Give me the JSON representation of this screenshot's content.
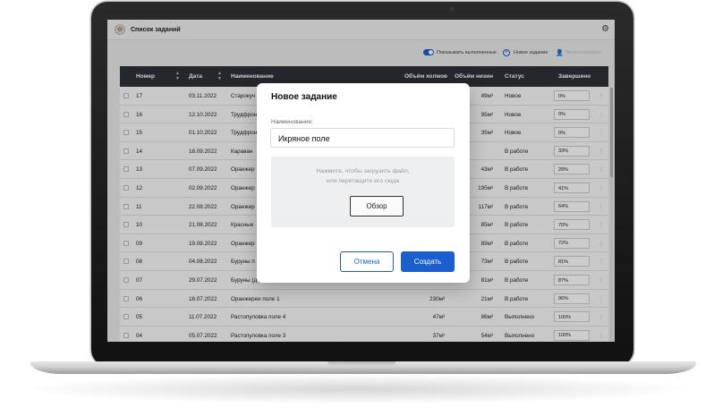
{
  "app": {
    "title": "Список заданий"
  },
  "toolbar": {
    "show_completed_label": "Показывать выполненные",
    "new_task_label": "Новое задание",
    "extra_label": "Экспортировать"
  },
  "table": {
    "columns": [
      "Номер",
      "Дата",
      "Наименование",
      "Объём холмов",
      "Объём низин",
      "Статус",
      "Завершено"
    ],
    "rows": [
      {
        "num": "17",
        "date": "03.11.2022",
        "name": "Старокуч",
        "hills": "",
        "low": "49м³",
        "status": "Новое",
        "pct": "0%"
      },
      {
        "num": "16",
        "date": "12.10.2022",
        "name": "Трудфрон",
        "hills": "",
        "low": "95м³",
        "status": "Новое",
        "pct": "0%"
      },
      {
        "num": "15",
        "date": "01.10.2022",
        "name": "Трудфрон",
        "hills": "",
        "low": "35м³",
        "status": "Новое",
        "pct": "0%"
      },
      {
        "num": "14",
        "date": "18.09.2022",
        "name": "Караван",
        "hills": "",
        "low": "",
        "status": "В работе",
        "pct": "33%"
      },
      {
        "num": "13",
        "date": "07.09.2022",
        "name": "Оранжер",
        "hills": "",
        "low": "43м³",
        "status": "В работе",
        "pct": "28%"
      },
      {
        "num": "12",
        "date": "02.09.2022",
        "name": "Оранжер",
        "hills": "",
        "low": "195м³",
        "status": "В работе",
        "pct": "41%"
      },
      {
        "num": "11",
        "date": "22.08.2022",
        "name": "Оранжер",
        "hills": "",
        "low": "117м³",
        "status": "В работе",
        "pct": "64%"
      },
      {
        "num": "10",
        "date": "21.08.2022",
        "name": "Красные",
        "hills": "",
        "low": "85м³",
        "status": "В работе",
        "pct": "70%"
      },
      {
        "num": "09",
        "date": "19.08.2022",
        "name": "Оранжер",
        "hills": "",
        "low": "89м³",
        "status": "В работе",
        "pct": "72%"
      },
      {
        "num": "08",
        "date": "04.08.2022",
        "name": "Буруны п",
        "hills": "",
        "low": "73м³",
        "status": "В работе",
        "pct": "81%"
      },
      {
        "num": "07",
        "date": "29.07.2022",
        "name": "Буруны (д",
        "hills": "",
        "low": "81м³",
        "status": "В работе",
        "pct": "87%"
      },
      {
        "num": "06",
        "date": "16.07.2022",
        "name": "Оранжереи поле 1",
        "hills": "230м³",
        "low": "21м³",
        "status": "В работе",
        "pct": "96%"
      },
      {
        "num": "05",
        "date": "11.07.2022",
        "name": "Растопуловка поле 4",
        "hills": "47м³",
        "low": "86м³",
        "status": "Выполнено",
        "pct": "100%"
      },
      {
        "num": "04",
        "date": "05.07.2022",
        "name": "Растопуловка поле 3",
        "hills": "37м³",
        "low": "54м³",
        "status": "Выполнено",
        "pct": "100%"
      }
    ]
  },
  "modal": {
    "title": "Новое задание",
    "name_label": "Наименование:",
    "name_value": "Икряное поле",
    "dropzone_line1": "Нажмите, чтобы загрузить файл,",
    "dropzone_line2": "или перетащите его сюда",
    "browse_label": "Обзор",
    "cancel_label": "Отмена",
    "create_label": "Создать"
  },
  "colors": {
    "accent": "#1a5fd0",
    "header": "#2e3338"
  }
}
